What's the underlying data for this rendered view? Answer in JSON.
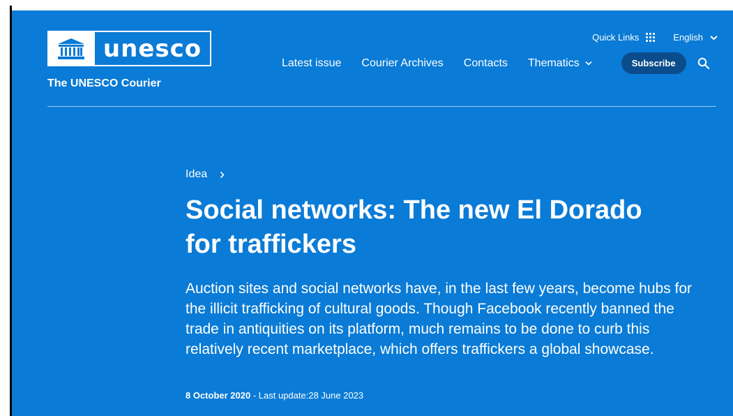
{
  "brand": {
    "logo_text": "unesco",
    "site_name": "The UNESCO Courier"
  },
  "topbar": {
    "quick_links": "Quick Links",
    "language": "English"
  },
  "nav": {
    "items": [
      "Latest issue",
      "Courier Archives",
      "Contacts",
      "Thematics"
    ],
    "subscribe": "Subscribe"
  },
  "article": {
    "category": "Idea",
    "title": "Social networks: The new El Dorado for traffickers",
    "lead": "Auction sites and social networks have, in the last few years, become hubs for the illicit trafficking of cultural goods. Though Facebook recently banned the trade in antiquities on its platform, much remains to be done to curb this relatively recent marketplace, which offers traffickers a global showcase.",
    "date": "8 October 2020",
    "separator": " - ",
    "update_label": "Last update:",
    "update_date": "28 June 2023"
  },
  "icons": {
    "grid": "grid-dots-icon",
    "chevron": "chevron-down-icon",
    "search": "search-icon",
    "breadcrumb_arrow": "chevron-right-icon",
    "emblem": "unesco-temple-icon"
  },
  "colors": {
    "background": "#0a7bd6",
    "subscribe_bg": "#0b4d8c",
    "text": "#ffffff"
  }
}
